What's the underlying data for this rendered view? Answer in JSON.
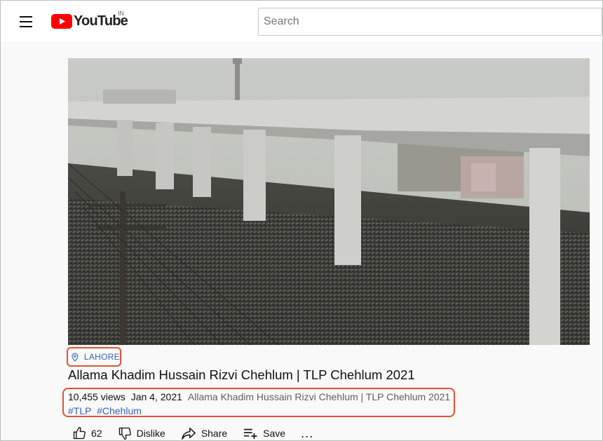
{
  "header": {
    "logo_text": "YouTube",
    "region": "IN",
    "search_placeholder": "Search"
  },
  "video": {
    "location": "LAHORE",
    "title": "Allama Khadim Hussain Rizvi Chehlum | TLP Chehlum 2021",
    "views": "10,455 views",
    "date": "Jan 4, 2021",
    "description": "Allama Khadim Hussain Rizvi Chehlum | TLP Chehlum 2021",
    "hashtags": [
      "#TLP",
      "#Chehlum"
    ]
  },
  "actions": {
    "like_count": "62",
    "dislike_label": "Dislike",
    "share_label": "Share",
    "save_label": "Save",
    "more_label": "..."
  },
  "colors": {
    "brand_red": "#ff0000",
    "link_blue": "#3361c4",
    "highlight_orange": "#e8502f"
  },
  "icons": {
    "menu": "hamburger-icon",
    "location": "location-pin-icon",
    "like": "thumbs-up-icon",
    "dislike": "thumbs-down-icon",
    "share": "share-arrow-icon",
    "save": "playlist-add-icon",
    "more": "more-horizontal-icon"
  }
}
